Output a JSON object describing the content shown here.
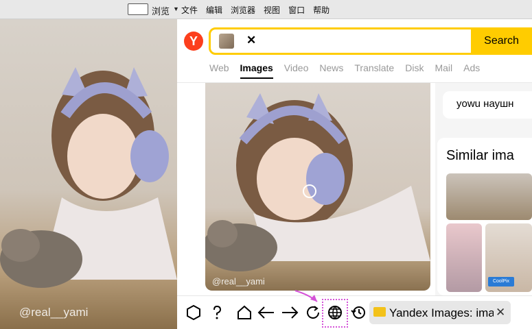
{
  "menubar": {
    "view_label": "浏览",
    "items": [
      "文件",
      "编辑",
      "浏览器",
      "视图",
      "窗口",
      "帮助"
    ]
  },
  "left_photo": {
    "watermark": "@real__yami"
  },
  "search": {
    "query_value": "",
    "button": "Search"
  },
  "tabs": [
    "Web",
    "Images",
    "Video",
    "News",
    "Translate",
    "Disk",
    "Mail",
    "Ads"
  ],
  "active_tab": "Images",
  "main_image": {
    "watermark": "@real__yami"
  },
  "right_panel": {
    "query_chip": "yowu наушн",
    "similar_title": "Similar ima",
    "coolpix_label": "CoolPix"
  },
  "toolbar": {
    "tab_label": "Yandex Images: ima",
    "icons": [
      "hexagon-icon",
      "help-icon",
      "home-icon",
      "back-arrow-icon",
      "forward-arrow-icon",
      "reload-icon",
      "globe-icon",
      "history-icon"
    ]
  },
  "colors": {
    "accent": "#ffcc00",
    "brand": "#fc3f1d",
    "annotation": "#d452d8"
  }
}
